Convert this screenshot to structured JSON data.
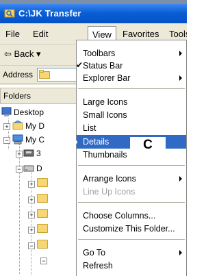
{
  "window": {
    "title": "C:\\JK Transfer"
  },
  "menubar": {
    "file": "File",
    "edit": "Edit",
    "view": "View",
    "favorites": "Favorites",
    "tools": "Tools"
  },
  "toolbar": {
    "back_label": "⇦ Back ▾"
  },
  "address": {
    "label": "Address"
  },
  "folders_pane": {
    "header": "Folders",
    "items": [
      "Desktop",
      "My D",
      "My C",
      "3",
      "D"
    ]
  },
  "view_menu": {
    "toolbars": "Toolbars",
    "status_bar": "Status Bar",
    "explorer_bar": "Explorer Bar",
    "large_icons": "Large Icons",
    "small_icons": "Small Icons",
    "list": "List",
    "details": "Details",
    "thumbnails": "Thumbnails",
    "arrange_icons": "Arrange Icons",
    "line_up_icons": "Line Up Icons",
    "choose_columns": "Choose Columns...",
    "customize_folder": "Customize This Folder...",
    "go_to": "Go To",
    "refresh": "Refresh"
  },
  "callout": {
    "letter": "C"
  },
  "colors": {
    "title_blue": "#0a5fd6",
    "highlight": "#316ac5",
    "chrome": "#ece9d8"
  },
  "icons": {
    "title": "folder-icon",
    "desktop": "desktop-icon",
    "docs": "my-documents-icon",
    "computer": "my-computer-icon"
  }
}
